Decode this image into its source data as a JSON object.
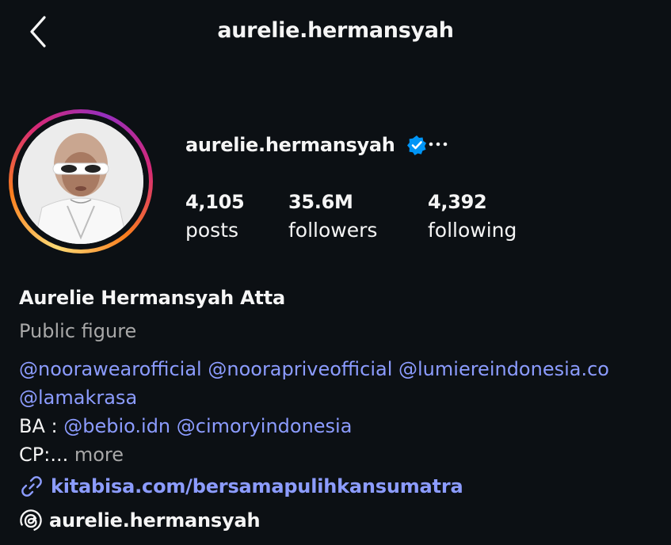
{
  "header": {
    "title": "aurelie.hermansyah",
    "back_icon": "chevron-left-icon"
  },
  "profile": {
    "username": "aurelie.hermansyah",
    "verified_icon": "verified-badge-icon",
    "more_icon": "ellipsis-icon",
    "stats": [
      {
        "value": "4,105",
        "label": "posts"
      },
      {
        "value": "35.6M",
        "label": "followers"
      },
      {
        "value": "4,392",
        "label": "following"
      }
    ],
    "full_name": "Aurelie Hermansyah Atta",
    "category": "Public figure",
    "bio": {
      "line1": [
        "@noorawearofficial",
        "@nooraprivеofficial",
        "@lumiereindonesia.co"
      ],
      "line2": "@lamakrasa",
      "ba_prefix": "BA : ",
      "ba_mentions": [
        "@bebio.idn",
        "@cimoryindonesia"
      ],
      "cp_text": "CP:... ",
      "more_label": "more"
    },
    "link": {
      "icon": "link-icon",
      "text": "kitabisa.com/bersamapulihkansumatra"
    },
    "threads": {
      "icon": "threads-icon",
      "text": "aurelie.hermansyah"
    }
  },
  "colors": {
    "background": "#0c1014",
    "text": "#f5f5f5",
    "muted": "#a8a8a8",
    "link": "#8c9cff",
    "verified": "#0095f6"
  }
}
